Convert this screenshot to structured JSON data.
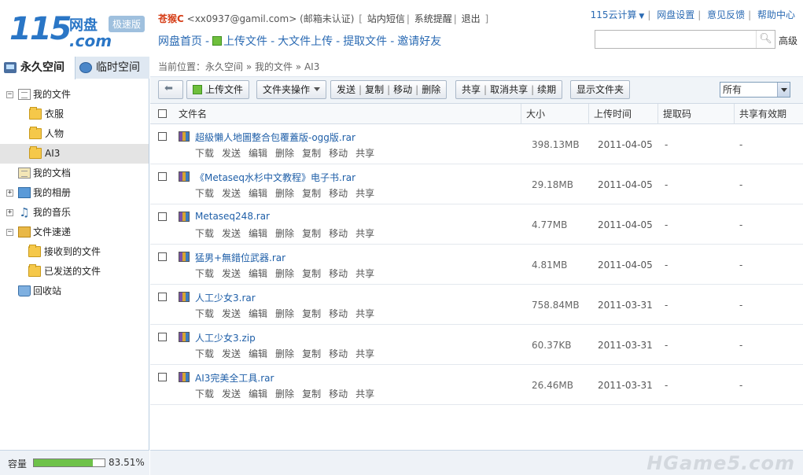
{
  "header": {
    "logo_num": "115",
    "logo_cn": "网盘",
    "logo_com": ".com",
    "logo_badge": "极速版",
    "username": "苍猴C",
    "email": "<xx0937@gamil.com>",
    "email_status": "(邮箱未认证)",
    "links": [
      "站内短信",
      "系统提醒",
      "退出"
    ],
    "nav": [
      "网盘首页",
      "上传文件",
      "大文件上传",
      "提取文件",
      "邀请好友"
    ],
    "topright": [
      "115云计算",
      "网盘设置",
      "意见反馈",
      "帮助中心"
    ],
    "search_placeholder": "",
    "advanced": "高级"
  },
  "sidebar": {
    "tabs": [
      "永久空间",
      "临时空间"
    ],
    "tree": [
      {
        "label": "我的文件",
        "level": 0,
        "expander": "-",
        "icon": "document-icon"
      },
      {
        "label": "衣服",
        "level": 1,
        "expander": "",
        "icon": "folder-icon"
      },
      {
        "label": "人物",
        "level": 1,
        "expander": "",
        "icon": "folder-icon"
      },
      {
        "label": "AI3",
        "level": 1,
        "expander": "",
        "icon": "folder-icon"
      },
      {
        "label": "我的文档",
        "level": 0,
        "expander": "",
        "icon": "docs-icon"
      },
      {
        "label": "我的相册",
        "level": 0,
        "expander": "+",
        "icon": "photo-icon"
      },
      {
        "label": "我的音乐",
        "level": 0,
        "expander": "+",
        "icon": "music-icon"
      },
      {
        "label": "文件速递",
        "level": 0,
        "expander": "-",
        "icon": "transfer-icon"
      },
      {
        "label": "接收到的文件",
        "level": 1,
        "expander": "",
        "icon": "folder-icon"
      },
      {
        "label": "已发送的文件",
        "level": 1,
        "expander": "",
        "icon": "folder-icon"
      },
      {
        "label": "回收站",
        "level": 0,
        "expander": "",
        "icon": "trash-icon"
      }
    ],
    "selected": "AI3",
    "capacity_label": "容量",
    "capacity_pct": "83.51%",
    "capacity_fill": 0.8351
  },
  "main": {
    "breadcrumb": "当前位置：永久空间 » 我的文件 » AI3",
    "toolbar": {
      "upload": "上传文件",
      "folder_ops": "文件夹操作",
      "group1": [
        "发送",
        "复制",
        "移动",
        "删除"
      ],
      "group2": [
        "共享",
        "取消共享",
        "续期"
      ],
      "show_folder": "显示文件夹",
      "filter_value": "所有"
    },
    "columns": [
      "文件名",
      "大小",
      "上传时间",
      "提取码",
      "共享有效期"
    ],
    "actions": [
      "下载",
      "发送",
      "编辑",
      "删除",
      "复制",
      "移动",
      "共享"
    ],
    "files": [
      {
        "name": "超級懶人地圖整合包覆蓋版-ogg版.rar",
        "size": "398.13MB",
        "date": "2011-04-05",
        "code": "-",
        "valid": "-"
      },
      {
        "name": "《Metaseq水杉中文教程》电子书.rar",
        "size": "29.18MB",
        "date": "2011-04-05",
        "code": "-",
        "valid": "-"
      },
      {
        "name": "Metaseq248.rar",
        "size": "4.77MB",
        "date": "2011-04-05",
        "code": "-",
        "valid": "-"
      },
      {
        "name": "猛男+無錯位武器.rar",
        "size": "4.81MB",
        "date": "2011-04-05",
        "code": "-",
        "valid": "-"
      },
      {
        "name": "人工少女3.rar",
        "size": "758.84MB",
        "date": "2011-03-31",
        "code": "-",
        "valid": "-"
      },
      {
        "name": "人工少女3.zip",
        "size": "60.37KB",
        "date": "2011-03-31",
        "code": "-",
        "valid": "-"
      },
      {
        "name": "AI3完美全工具.rar",
        "size": "26.46MB",
        "date": "2011-03-31",
        "code": "-",
        "valid": "-"
      }
    ],
    "watermark": "HGame5.com"
  }
}
